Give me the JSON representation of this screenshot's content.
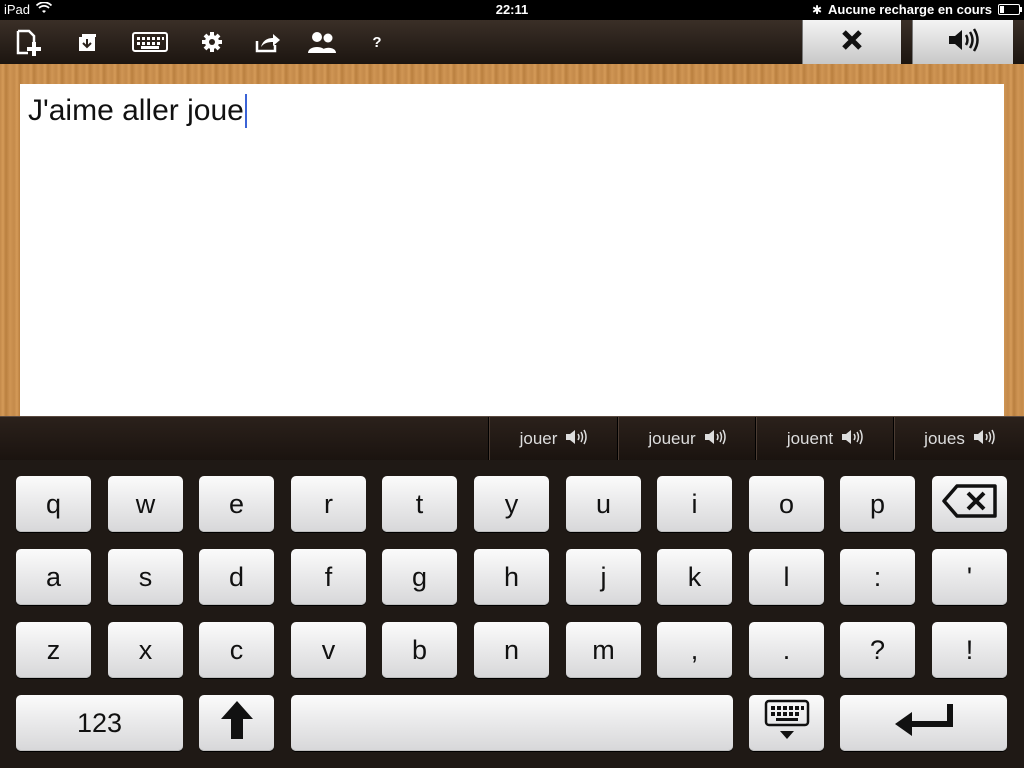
{
  "status_bar": {
    "device": "iPad",
    "time": "22:11",
    "charging_status": "Aucune recharge en cours"
  },
  "toolbar": {
    "icons": [
      "new-document-icon",
      "open-folder-icon",
      "keyboard-icon",
      "settings-gear-icon",
      "share-icon",
      "users-icon",
      "help-icon"
    ],
    "help_label": "?",
    "right_buttons": [
      "clear-icon",
      "speak-icon"
    ]
  },
  "editor": {
    "text": "J'aime aller joue"
  },
  "suggestions": [
    "jouer",
    "joueur",
    "jouent",
    "joues"
  ],
  "keyboard": {
    "row1": [
      "q",
      "w",
      "e",
      "r",
      "t",
      "y",
      "u",
      "i",
      "o",
      "p"
    ],
    "row2": [
      "a",
      "s",
      "d",
      "f",
      "g",
      "h",
      "j",
      "k",
      "l",
      ":",
      "'"
    ],
    "row3": [
      "z",
      "x",
      "c",
      "v",
      "b",
      "n",
      "m",
      ",",
      ".",
      "?",
      "!"
    ],
    "numbers_label": "123"
  },
  "colors": {
    "caret": "#3b63d6",
    "toolbar_bg": "#2a211b",
    "wood": "#c48a4a"
  }
}
